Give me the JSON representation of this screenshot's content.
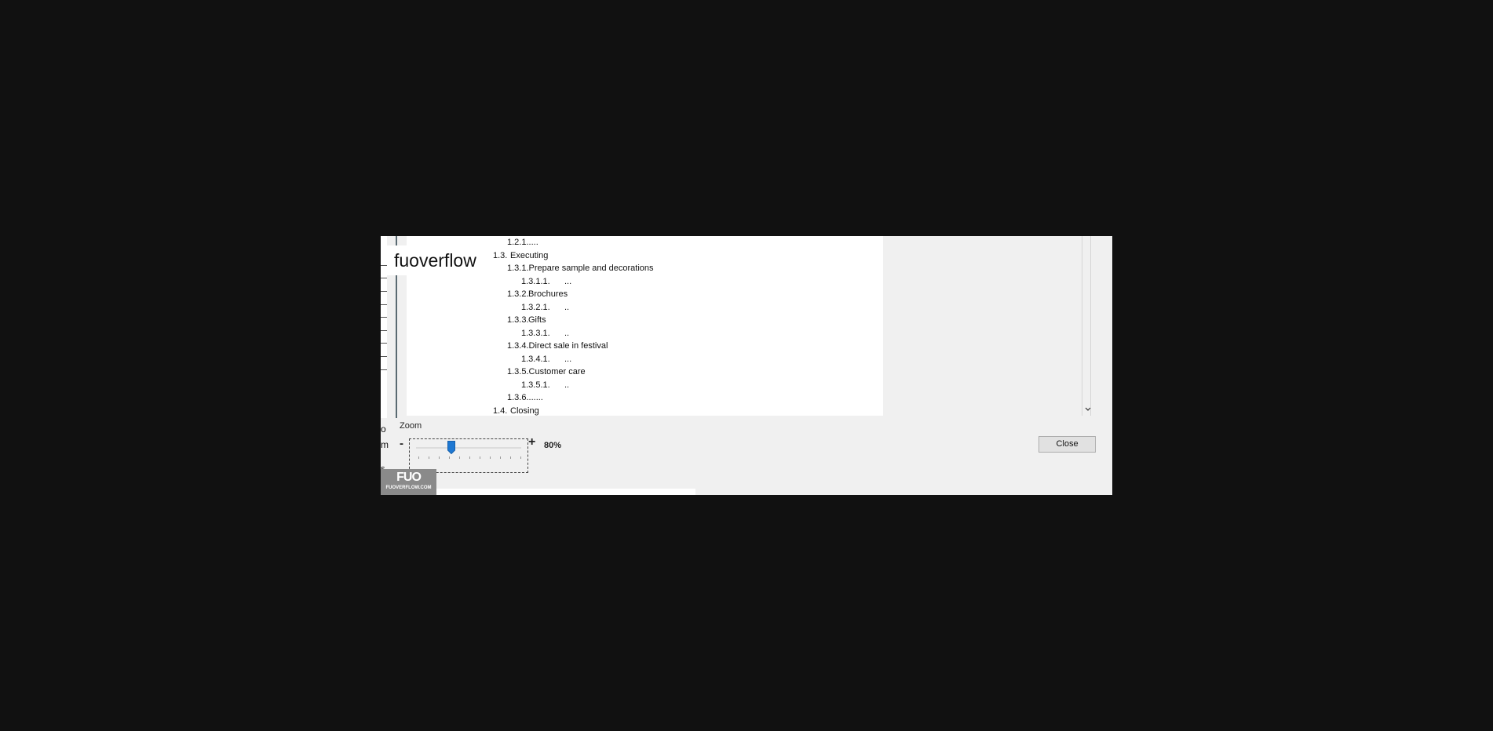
{
  "brand": {
    "overlay_text": "fuoverflow",
    "badge_mark": "FUO",
    "badge_sub": "FUOVERFLOW.COM"
  },
  "outline": [
    {
      "num": "1.2.1.",
      "text": "...."
    },
    {
      "num": "1.3.",
      "text": "Executing"
    },
    {
      "num": "1.3.1.",
      "text": "Prepare sample and decorations"
    },
    {
      "num": "1.3.1.1.",
      "text": "..."
    },
    {
      "num": "1.3.2.",
      "text": "Brochures"
    },
    {
      "num": "1.3.2.1.",
      "text": ".."
    },
    {
      "num": "1.3.3.",
      "text": "Gifts"
    },
    {
      "num": "1.3.3.1.",
      "text": ".."
    },
    {
      "num": "1.3.4.",
      "text": "Direct sale in festival"
    },
    {
      "num": "1.3.4.1.",
      "text": "..."
    },
    {
      "num": "1.3.5.",
      "text": "Customer care"
    },
    {
      "num": "1.3.5.1.",
      "text": ".."
    },
    {
      "num": "1.3.6.",
      "text": "......"
    },
    {
      "num": "1.4.",
      "text": "Closing"
    }
  ],
  "left_clipped_letters": [
    "o",
    "m",
    "s"
  ],
  "zoom": {
    "label": "Zoom",
    "minus": "-",
    "plus": "+",
    "percent_label": "80%",
    "value_percent": 80
  },
  "buttons": {
    "close": "Close"
  },
  "icons": {
    "scroll_down": "chevron-down-icon"
  }
}
